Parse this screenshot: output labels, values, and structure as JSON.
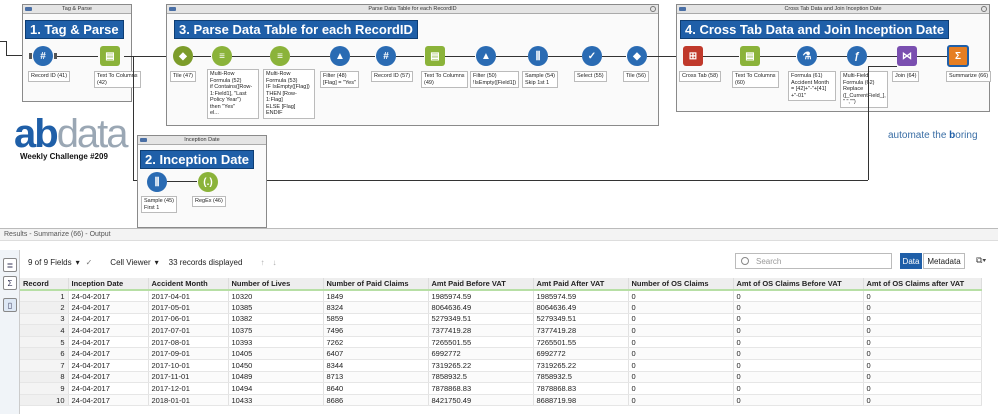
{
  "containers": {
    "tag_parse": {
      "title": "Tag & Parse",
      "comment": "1. Tag & Parse"
    },
    "parse_table": {
      "title": "Parse Data Table for each RecordID",
      "comment": "3. Parse Data Table for each RecordID"
    },
    "crosstab": {
      "title": "Cross Tab Data and Join Inception Date",
      "comment": "4. Cross Tab Data and Join Inception Date"
    },
    "inception": {
      "title": "Inception Date",
      "comment": "2. Inception Date"
    }
  },
  "tools": {
    "record_id_41": "Record ID (41)",
    "text_to_columns_42": "Text To Columns\n(42)",
    "tile_47": "Tile (47)",
    "multirow_52": "Multi-Row\nFormula (52)\nif Contains([Row-\n1:Field1], \"Last\nPolicy Year\")\nthen \"Yes\"\nel...",
    "multirow_53": "Multi-Row\nFormula (53)\nIF IsEmpty([Flag])\nTHEN [Row-\n1:Flag]\nELSE [Flag]\nENDIF",
    "filter_48": "Filter (48)\n[Flag] = \"Yes\"",
    "record_id_57": "Record ID (57)",
    "text_to_columns_49": "Text To Columns\n(49)",
    "filter_50": "Filter (50)\n!IsEmpty([Field1])",
    "sample_54": "Sample (54)\nSkip 1st 1",
    "select_55": "Select (55)",
    "tile_56": "Tile (56)",
    "crosstab_58": "Cross Tab (58)",
    "text_to_columns_60": "Text To Columns\n(60)",
    "formula_61": "Formula (61)\nAccident Month\n= [42]+\"-\"+[41]\n+\"-01\"",
    "multifield_62": "Multi-Field\nFormula (62)\nReplace\n([_CurrentField_],\n\" \",\"\")",
    "join_64": "Join (64)",
    "summarize_66": "Summarize (66)",
    "sample_45": "Sample (45)\nFirst 1",
    "regex_46": "RegEx (46)"
  },
  "branding": {
    "logo_ab": "ab",
    "logo_data": "data",
    "weekly": "Weekly Challenge #209",
    "tagline_pre": "automate the ",
    "tagline_b": "b",
    "tagline_post": "oring"
  },
  "results": {
    "header": "Results - Summarize (66) - Output",
    "fields": "9 of 9 Fields",
    "viewer": "Cell Viewer",
    "records": "33 records displayed",
    "search_placeholder": "Search",
    "data_btn": "Data",
    "metadata_btn": "Metadata"
  },
  "table": {
    "columns": [
      "Record",
      "Inception Date",
      "Accident Month",
      "Number of Lives",
      "Number of Paid Claims",
      "Amt Paid Before VAT",
      "Amt Paid After VAT",
      "Number of OS Claims",
      "Amt of OS Claims Before VAT",
      "Amt of OS Claims after VAT"
    ],
    "rows": [
      [
        "1",
        "24-04-2017",
        "2017-04-01",
        "10320",
        "1849",
        "1985974.59",
        "1985974.59",
        "0",
        "0",
        "0"
      ],
      [
        "2",
        "24-04-2017",
        "2017-05-01",
        "10385",
        "8324",
        "8064636.49",
        "8064636.49",
        "0",
        "0",
        "0"
      ],
      [
        "3",
        "24-04-2017",
        "2017-06-01",
        "10382",
        "5859",
        "5279349.51",
        "5279349.51",
        "0",
        "0",
        "0"
      ],
      [
        "4",
        "24-04-2017",
        "2017-07-01",
        "10375",
        "7496",
        "7377419.28",
        "7377419.28",
        "0",
        "0",
        "0"
      ],
      [
        "5",
        "24-04-2017",
        "2017-08-01",
        "10393",
        "7262",
        "7265501.55",
        "7265501.55",
        "0",
        "0",
        "0"
      ],
      [
        "6",
        "24-04-2017",
        "2017-09-01",
        "10405",
        "6407",
        "6992772",
        "6992772",
        "0",
        "0",
        "0"
      ],
      [
        "7",
        "24-04-2017",
        "2017-10-01",
        "10450",
        "8344",
        "7319265.22",
        "7319265.22",
        "0",
        "0",
        "0"
      ],
      [
        "8",
        "24-04-2017",
        "2017-11-01",
        "10489",
        "8713",
        "7858932.5",
        "7858932.5",
        "0",
        "0",
        "0"
      ],
      [
        "9",
        "24-04-2017",
        "2017-12-01",
        "10494",
        "8640",
        "7878868.83",
        "7878868.83",
        "0",
        "0",
        "0"
      ],
      [
        "10",
        "24-04-2017",
        "2018-01-01",
        "10433",
        "8686",
        "8421750.49",
        "8688719.98",
        "0",
        "0",
        "0"
      ]
    ]
  },
  "colors": {
    "accent": "#1f5fa8",
    "in_out": "#2a6bb3",
    "prep": "#8bb33a",
    "join": "#7a4fb0",
    "parse": "#c0392b"
  }
}
